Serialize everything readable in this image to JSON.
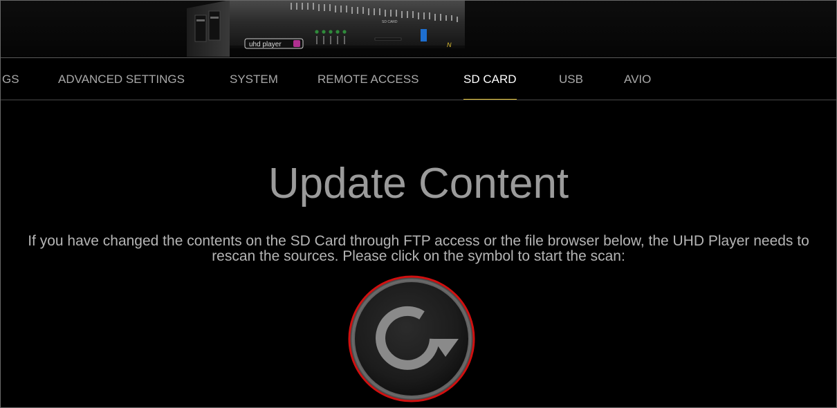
{
  "header": {
    "device_brand_label": "uhd player",
    "device_ports_caption": "SD CARD"
  },
  "nav": {
    "tabs": [
      {
        "label": "GS",
        "active": false
      },
      {
        "label": "ADVANCED SETTINGS",
        "active": false
      },
      {
        "label": "SYSTEM",
        "active": false
      },
      {
        "label": "REMOTE ACCESS",
        "active": false
      },
      {
        "label": "SD CARD",
        "active": true
      },
      {
        "label": "USB",
        "active": false
      },
      {
        "label": "AVIO",
        "active": false
      }
    ]
  },
  "main": {
    "title": "Update Content",
    "description": "If you have changed the contents on the SD Card through FTP access or the file browser below, the UHD Player needs to rescan the sources. Please click on the symbol to start the scan:",
    "scan_button": {
      "icon": "refresh-icon",
      "ring_color": "#d01010",
      "icon_color": "#8a8a8a"
    }
  },
  "colors": {
    "background": "#000000",
    "active_tab_underline": "#e2c232",
    "tab_text": "#a9a9a9",
    "active_tab_text": "#ffffff"
  }
}
